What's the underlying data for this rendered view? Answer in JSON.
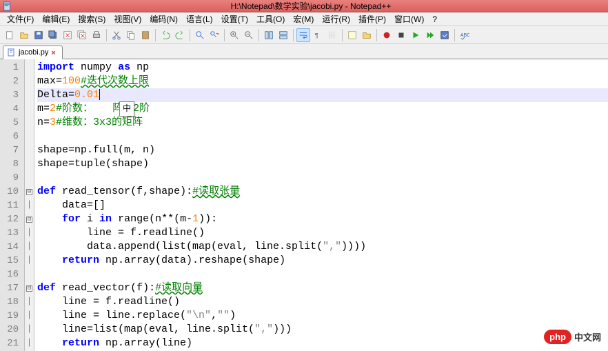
{
  "window": {
    "title": "H:\\Notepad\\数学实验\\jacobi.py - Notepad++"
  },
  "menus": [
    "文件(F)",
    "编辑(E)",
    "搜索(S)",
    "视图(V)",
    "编码(N)",
    "语言(L)",
    "设置(T)",
    "工具(O)",
    "宏(M)",
    "运行(R)",
    "插件(P)",
    "窗口(W)",
    "?"
  ],
  "toolbar_icons": [
    "new-file-icon",
    "open-file-icon",
    "save-icon",
    "save-all-icon",
    "close-icon",
    "close-all-icon",
    "print-icon",
    "sep",
    "cut-icon",
    "copy-icon",
    "paste-icon",
    "sep",
    "undo-icon",
    "redo-icon",
    "sep",
    "find-icon",
    "replace-icon",
    "sep",
    "zoom-in-icon",
    "zoom-out-icon",
    "sep",
    "sync-v-icon",
    "sync-h-icon",
    "sep",
    "wrap-icon",
    "show-chars-icon",
    "indent-guide-icon",
    "sep",
    "lang-icon",
    "folder-icon",
    "sep",
    "record-icon",
    "stop-icon",
    "play-icon",
    "play-multi-icon",
    "save-macro-icon",
    "sep",
    "spell-icon"
  ],
  "tab": {
    "label": "jacobi.py",
    "close_glyph": "×"
  },
  "ime_glyph": "中",
  "gutter": [
    "1",
    "2",
    "3",
    "4",
    "5",
    "6",
    "7",
    "8",
    "9",
    "10",
    "11",
    "12",
    "13",
    "14",
    "15",
    "16",
    "17",
    "18",
    "19",
    "20",
    "21"
  ],
  "fold_rows": {
    "10": "⊟",
    "12": "⊟",
    "17": "⊟"
  },
  "code": {
    "l1": {
      "kw1": "import",
      "sp1": " ",
      "id1": "numpy",
      "sp2": " ",
      "kw2": "as",
      "sp3": " ",
      "id2": "np"
    },
    "l2": {
      "id": "max",
      "op": "=",
      "num": "100",
      "cmt": "#迭代次数上限"
    },
    "l3": {
      "id": "Delta",
      "op": "=",
      "num": "0.01"
    },
    "l4": {
      "id": "m",
      "op": "=",
      "num": "2",
      "cmt1": "#阶数：",
      "cmt2": "阵为2阶"
    },
    "l5": {
      "id": "n",
      "op": "=",
      "num": "3",
      "cmt": "#维数：3x3的矩阵"
    },
    "l7": {
      "txt": "shape=np.full(m, n)"
    },
    "l8": {
      "txt": "shape=tuple(shape)"
    },
    "l10": {
      "kw": "def",
      "sp": " ",
      "fn": "read_tensor",
      "args": "(f,shape):",
      "cmt": "#读取张量"
    },
    "l11": {
      "txt": "    data=[]"
    },
    "l12": {
      "pfx": "    ",
      "kw1": "for",
      "mid": " i ",
      "kw2": "in",
      "rest": " range(n**(m-",
      "num": "1",
      "tail": ")):"
    },
    "l13": {
      "txt": "        line = f.readline()"
    },
    "l14": {
      "pfx": "        data.append(list(map(eval, line.split(",
      "str": "\",\"",
      "tail": "))))"
    },
    "l15": {
      "pfx": "    ",
      "kw": "return",
      "rest": " np.array(data).reshape(shape)"
    },
    "l17": {
      "kw": "def",
      "sp": " ",
      "fn": "read_vector",
      "args": "(f):",
      "cmt": "#读取向量"
    },
    "l18": {
      "txt": "    line = f.readline()"
    },
    "l19": {
      "pfx": "    line = line.replace(",
      "s1": "\"\\n\"",
      "mid": ",",
      "s2": "\"\"",
      "tail": ")"
    },
    "l20": {
      "pfx": "    line=list(map(eval, line.split(",
      "str": "\",\"",
      "tail": ")))"
    },
    "l21": {
      "pfx": "    ",
      "kw": "return",
      "rest": " np.array(line)"
    }
  },
  "watermark": {
    "badge": "php",
    "text": "中文网"
  }
}
